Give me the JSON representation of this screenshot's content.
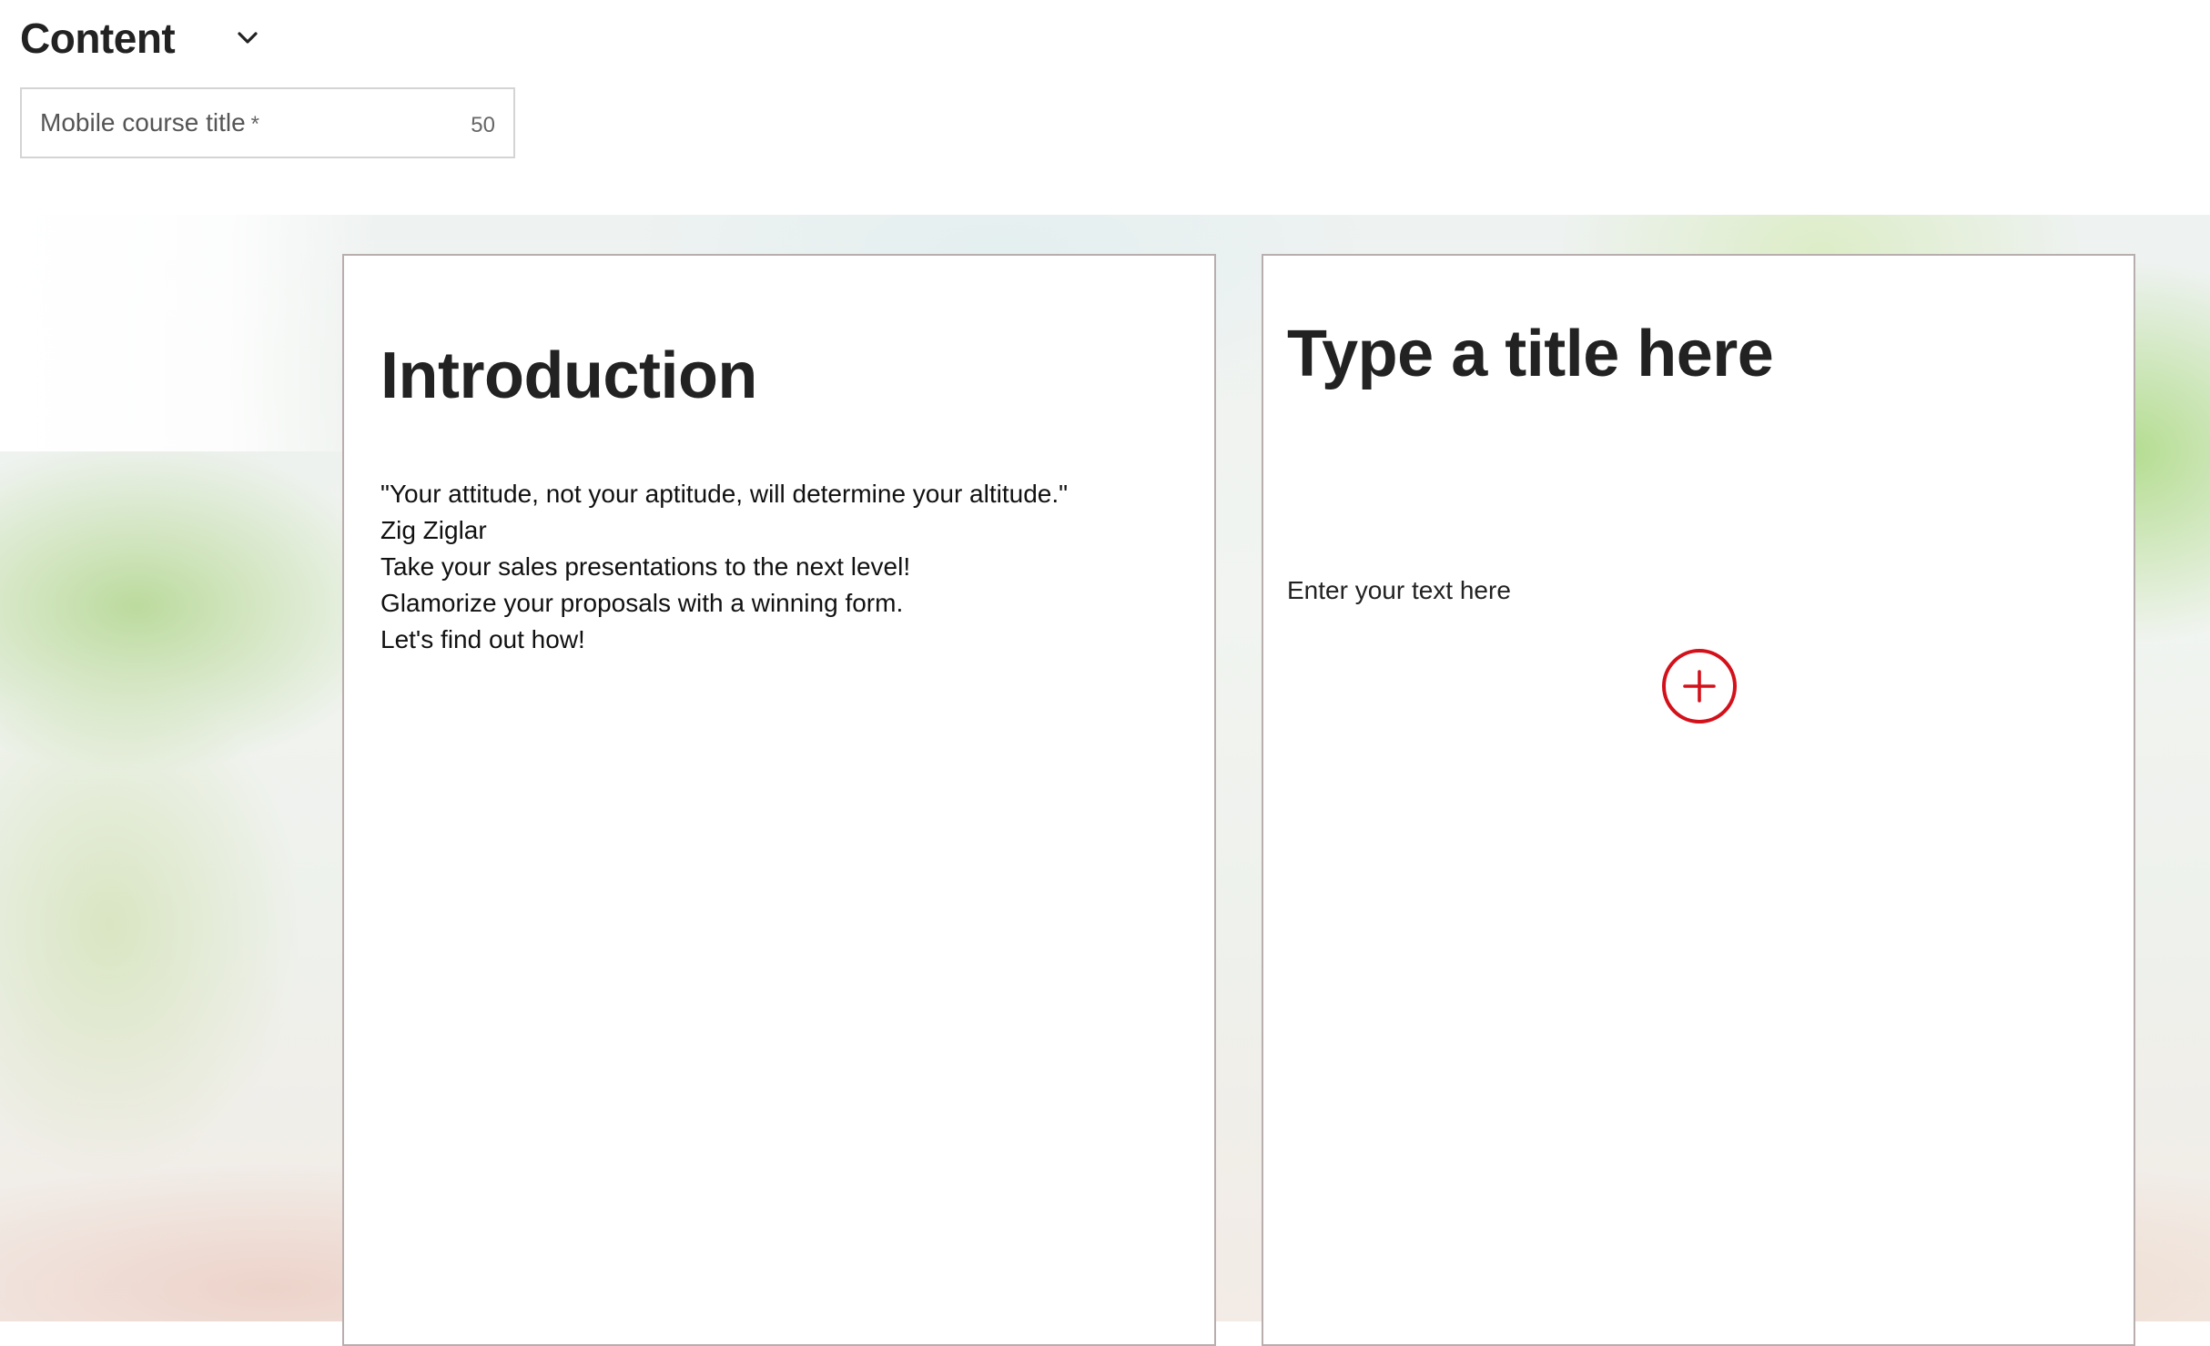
{
  "header": {
    "title": "Content",
    "toggle_icon": "chevron-down-icon"
  },
  "title_field": {
    "label": "Mobile course title",
    "required_marker": "*",
    "counter": "50"
  },
  "cards": [
    {
      "heading": "Introduction",
      "lines": [
        "\"Your attitude, not your aptitude, will determine your altitude.\"",
        "Zig Ziglar",
        "Take your sales presentations to the next level!",
        "Glamorize your proposals with a winning form.",
        "Let's find out how!"
      ]
    },
    {
      "heading": "Type a title here",
      "text": "Enter your text here",
      "add_icon": "plus-circle-icon"
    }
  ],
  "colors": {
    "accent": "#d3111b",
    "card_border": "#b9aeae",
    "text": "#222222"
  }
}
